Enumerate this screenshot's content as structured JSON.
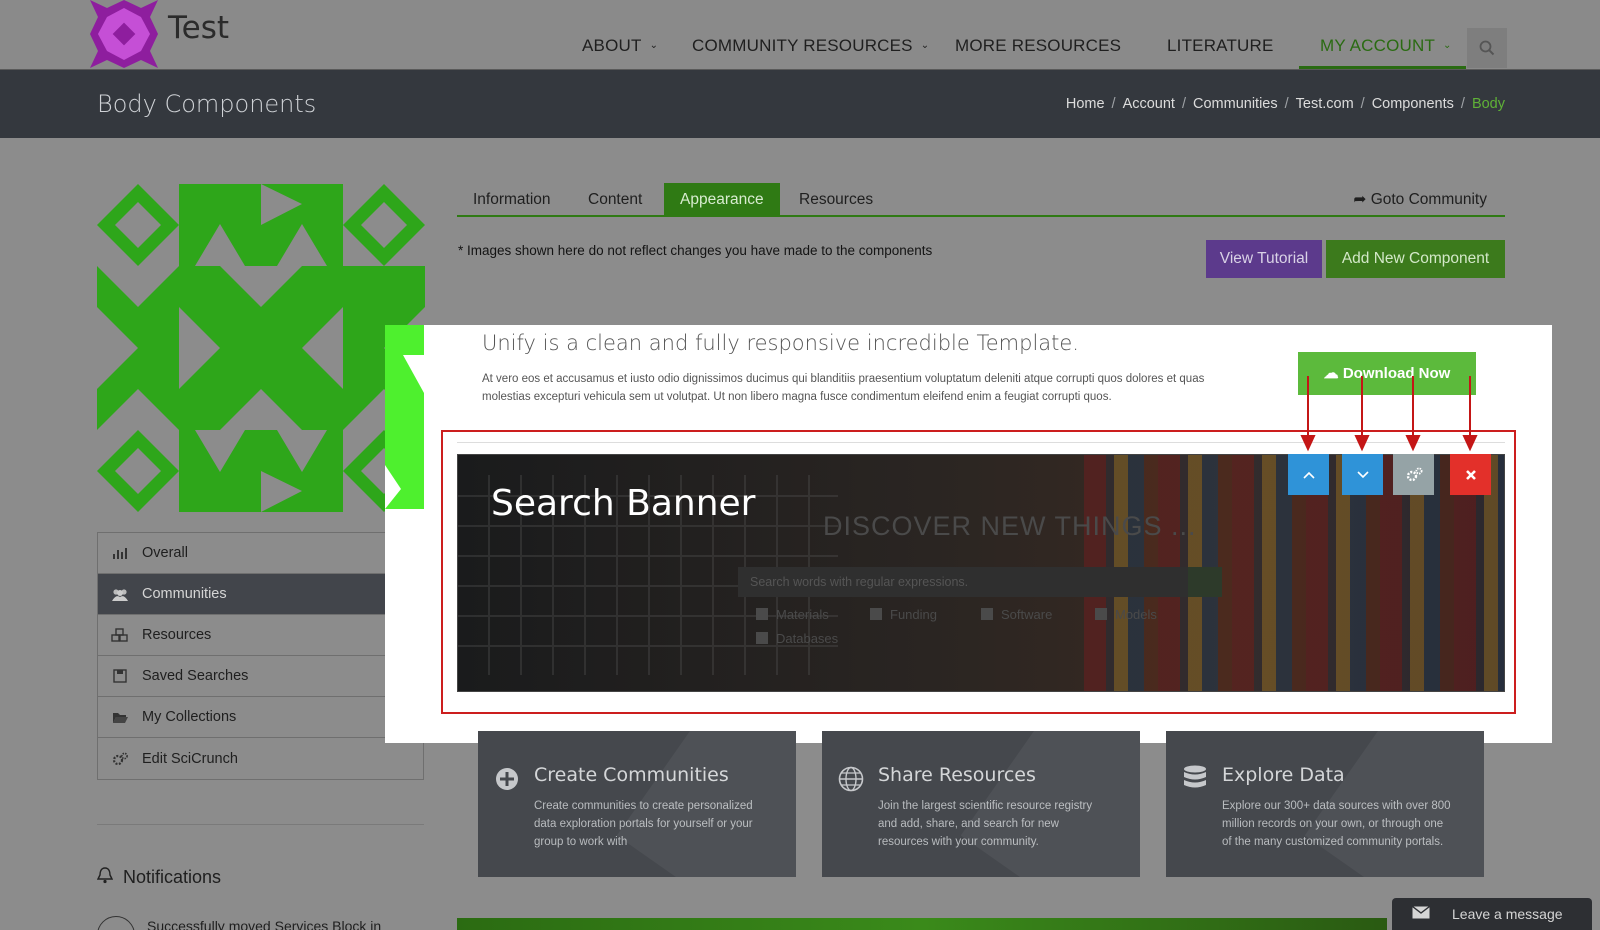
{
  "brand": {
    "name": "Test",
    "logo_icon": "pattern-logo-icon"
  },
  "nav": {
    "items": [
      {
        "label": "ABOUT",
        "has_caret": true
      },
      {
        "label": "COMMUNITY RESOURCES",
        "has_caret": true
      },
      {
        "label": "MORE RESOURCES",
        "has_caret": false
      },
      {
        "label": "LITERATURE",
        "has_caret": false
      },
      {
        "label": "MY ACCOUNT",
        "has_caret": true,
        "active": true
      }
    ],
    "search_icon": "search-icon"
  },
  "titlebar": {
    "title": "Body Components",
    "breadcrumb": [
      "Home",
      "Account",
      "Communities",
      "Test.com",
      "Components",
      "Body"
    ]
  },
  "sidebar": {
    "items": [
      {
        "label": "Overall",
        "icon": "bar-chart-icon"
      },
      {
        "label": "Communities",
        "icon": "users-icon",
        "active": true
      },
      {
        "label": "Resources",
        "icon": "cubes-icon"
      },
      {
        "label": "Saved Searches",
        "icon": "floppy-icon"
      },
      {
        "label": "My Collections",
        "icon": "folder-open-icon"
      },
      {
        "label": "Edit SciCrunch",
        "icon": "gears-icon"
      }
    ],
    "notifications": {
      "title": "Notifications",
      "first_text": "Successfully moved Services Block in"
    }
  },
  "tabs": {
    "items": [
      "Information",
      "Content",
      "Appearance",
      "Resources"
    ],
    "active": "Appearance",
    "goto_label": "Goto Community"
  },
  "note": "* Images shown here do not reflect changes you have made to the components",
  "buttons": {
    "tutorial": "View Tutorial",
    "add": "Add New Component"
  },
  "preview": {
    "headline": "Unify is a clean and fully responsive incredible Template.",
    "body": "At vero eos et accusamus et iusto odio dignissimos ducimus qui blanditiis praesentium voluptatum deleniti atque corrupti quos dolores et quas molestias excepturi vehicula sem ut volutpat. Ut non libero magna fusce condimentum eleifend enim a feugiat corrupti quos.",
    "download_label": "Download Now"
  },
  "banner": {
    "title": "Search Banner",
    "discover": "DISCOVER NEW THINGS ...",
    "search_placeholder": "Search words with regular expressions.",
    "checkboxes": [
      "Materials",
      "Funding",
      "Software",
      "Models",
      "Databases"
    ]
  },
  "controls": {
    "move_up": "chevron-up-icon",
    "move_down": "chevron-down-icon",
    "settings": "gears-icon",
    "delete": "close-icon"
  },
  "cards": [
    {
      "title": "Create Communities",
      "text": "Create communities to create personalized data exploration portals for yourself or your group to work with",
      "icon": "plus-circle-icon"
    },
    {
      "title": "Share Resources",
      "text": "Join the largest scientific resource registry and add, share, and search for new resources with your community.",
      "icon": "globe-icon"
    },
    {
      "title": "Explore Data",
      "text": "Explore our 300+ data sources with over 800 million records on your own, or through one of the many customized community portals.",
      "icon": "database-icon"
    }
  ],
  "chat": {
    "label": "Leave a message",
    "icon": "envelope-icon"
  },
  "colors": {
    "accent_green": "#2f7a14",
    "purple": "#5c3a8c",
    "blue": "#2f93d8",
    "red": "#e3302a"
  }
}
